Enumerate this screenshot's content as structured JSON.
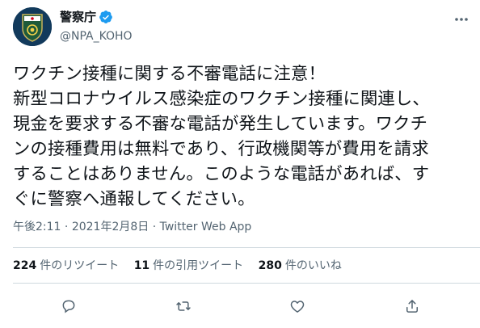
{
  "author": {
    "display_name": "警察庁",
    "handle": "@NPA_KOHO",
    "verified_icon": "verified-badge-icon",
    "avatar_icon": "police-emblem-icon"
  },
  "tweet": {
    "lines": [
      "ワクチン接種に関する不審電話に注意！",
      "新型コロナウイルス感染症のワクチン接種に関連し、",
      "現金を要求する不審な電話が発生しています。ワクチ",
      "ンの接種費用は無料であり、行政機関等が費用を請求",
      "することはありません。このような電話があれば、す",
      "ぐに警察へ通報してください。"
    ],
    "time": "午後2:11",
    "date": "2021年2月8日",
    "separator": "·",
    "source": "Twitter Web App"
  },
  "stats": {
    "retweets_count": "224",
    "retweets_label": "件のリツイート",
    "quotes_count": "11",
    "quotes_label": "件の引用ツイート",
    "likes_count": "280",
    "likes_label": "件のいいね"
  },
  "actions": {
    "reply_icon": "reply-icon",
    "retweet_icon": "retweet-icon",
    "like_icon": "heart-icon",
    "share_icon": "share-icon",
    "more_icon": "more-icon"
  },
  "colors": {
    "text": "#0f1419",
    "secondary": "#536471",
    "verified": "#1d9bf0",
    "border": "#cfd9de"
  }
}
